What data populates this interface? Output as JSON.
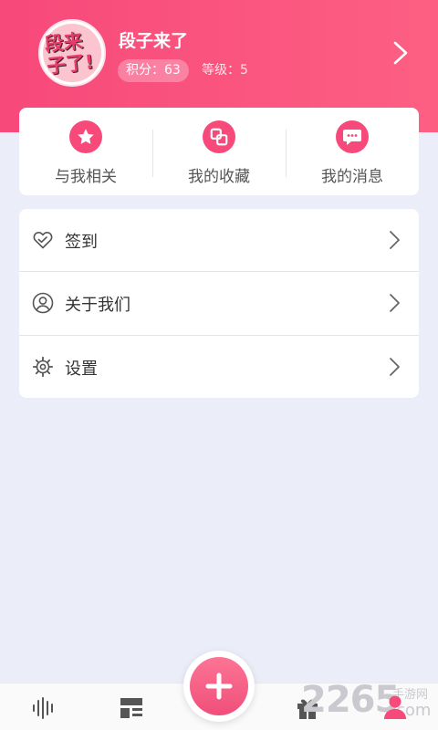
{
  "profile": {
    "avatar_text": "段来子了!",
    "name": "段子来了",
    "points": "积分：63",
    "level": "等级：5"
  },
  "quick_actions": [
    {
      "label": "与我相关",
      "icon": "star-icon"
    },
    {
      "label": "我的收藏",
      "icon": "collection-icon"
    },
    {
      "label": "我的消息",
      "icon": "message-icon"
    }
  ],
  "menu": [
    {
      "label": "签到",
      "icon": "heart-icon"
    },
    {
      "label": "关于我们",
      "icon": "user-circle-icon"
    },
    {
      "label": "设置",
      "icon": "gear-icon"
    }
  ],
  "tabs": [
    {
      "name": "audio",
      "icon": "waveform-icon"
    },
    {
      "name": "feed",
      "icon": "layout-icon"
    },
    {
      "name": "add",
      "icon": "plus-icon"
    },
    {
      "name": "gift",
      "icon": "gift-icon"
    },
    {
      "name": "me",
      "icon": "person-icon"
    }
  ],
  "watermark": {
    "number": "2265",
    "site_cn": "手游网",
    "domain_suffix": "com"
  },
  "colors": {
    "accent": "#f7497a",
    "background": "#ebeef8",
    "card": "#ffffff"
  }
}
